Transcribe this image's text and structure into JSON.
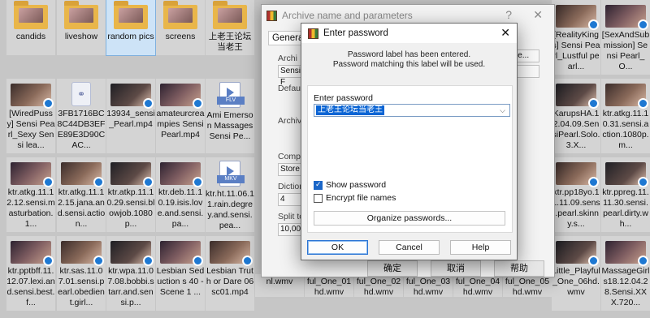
{
  "files": {
    "row1": [
      "candids",
      "liveshow",
      "random pics",
      "screens",
      "上老王论坛当老王",
      "[RealityKings] Sensi Pearl_Lustful pearl...",
      "[SexAndSubmission] Sensi Pearl_O..."
    ],
    "row2_left": [
      "[WiredPussy] Sensi Pearl_Sexy Sensi lea...",
      "3FB1716BC8C44DB3EFE89E3D90CAC...",
      "13934_sensi_Pearl.mp4",
      "amateurcreampies Sensi Pearl.mp4",
      "Ami Emerson Massages Sensi Pe..."
    ],
    "row2_right": [
      "KarupsHA.12.04.09.SensiPearl.Solo.3.X...",
      "ktr.atkg.11.10.31.sensi.action.1080p.m..."
    ],
    "row3_left": [
      "ktr.atkg.11.12.12.sensi.masturbation.1...",
      "ktr.atkg.11.12.15.jana.and.sensi.action...",
      "ktr.atkp.11.10.29.sensi.blowjob.1080p...",
      "ktr.deb.11.10.19.isis.love.and.sensi.pa...",
      "ktr.ht.11.06.11.rain.degrey.and.sensi.pea..."
    ],
    "row3_right": [
      "ktr.pp18yo.11.11.09.sensi.pearl.skinny.s...",
      "ktr.ppreg.11.11.30.sensi.pearl.dirty.wh..."
    ],
    "row4_left": [
      "ktr.pptbff.11.12.07.lexi.and.sensi.best.f...",
      "ktr.sas.11.07.01.sensi.pearl.obedient.girl...",
      "ktr.wpa.11.07.08.bobbi.starr.and.sensi.p...",
      "Lesbian Seduction s 40 - Scene 1 ...",
      "Lesbian Truth or Dare 06 sc01.mp4"
    ],
    "row4_mid": [
      "nl.wmv",
      "ful_One_01hd.wmv",
      "ful_One_02hd.wmv",
      "ful_One_03hd.wmv",
      "ful_One_04hd.wmv",
      "ful_One_05hd.wmv"
    ],
    "row4_right": [
      "Little_Playful_One_06hd.wmv",
      "MassageGirls18.12.04.28.Sensi.XXX.720..."
    ],
    "badges": {
      "flv": "FLV",
      "mkv": "MKV"
    }
  },
  "bg_dialog": {
    "title": "Archive name and parameters",
    "help_btn": "?",
    "close_btn": "✕",
    "tab": "General",
    "labels": [
      "Archi",
      "Sensi F",
      "Default",
      "Archiv",
      "Compre",
      "Store",
      "Dictiona",
      "4",
      "Split to",
      "10,000"
    ],
    "browse": "wse...",
    "ok": "确定",
    "cancel": "取消",
    "help": "帮助"
  },
  "pwd_dialog": {
    "title": "Enter password",
    "close": "✕",
    "info_line1": "Password label has been entered.",
    "info_line2": "Password matching this label will be used.",
    "enter_label": "Enter password",
    "password_value": "上老王论坛当老王",
    "show_password": "Show password",
    "encrypt_names": "Encrypt file names",
    "organize": "Organize passwords...",
    "ok": "OK",
    "cancel": "Cancel",
    "help": "Help"
  }
}
